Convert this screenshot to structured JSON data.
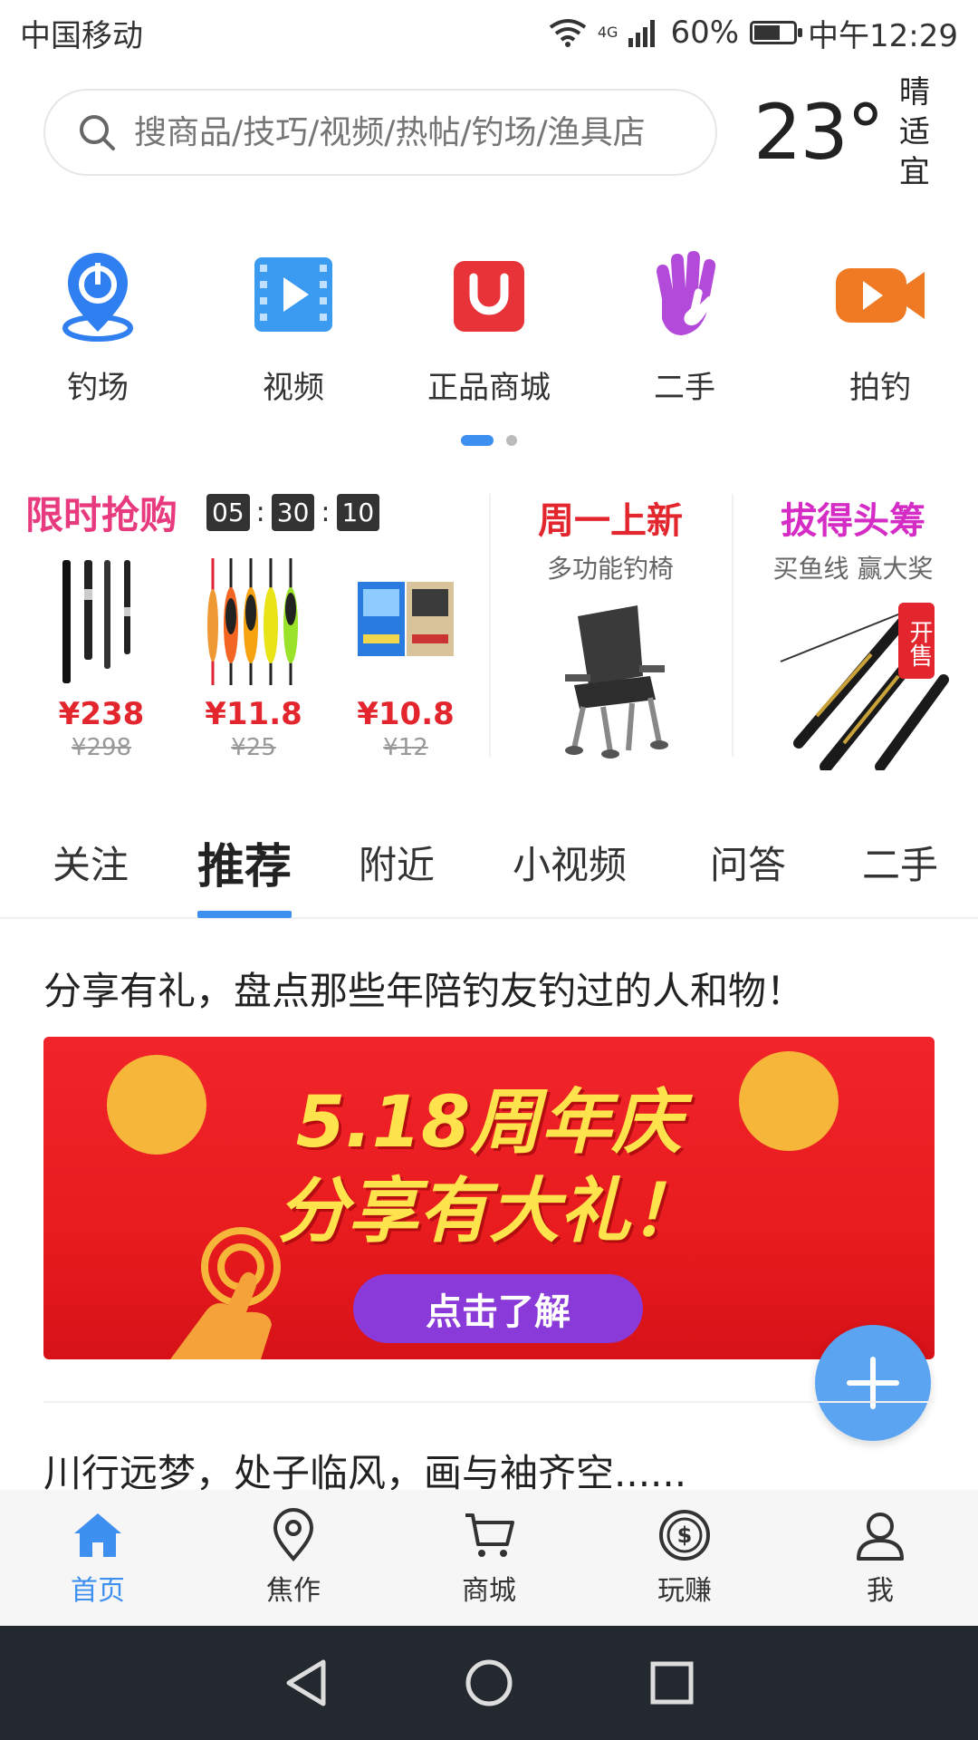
{
  "status": {
    "carrier": "中国移动",
    "network": "4G",
    "battery": "60%",
    "time": "中午12:29"
  },
  "search": {
    "placeholder": "搜商品/技巧/视频/热帖/钓场/渔具店"
  },
  "weather": {
    "temp": "23°",
    "condition": "晴",
    "comfort": "适宜"
  },
  "categories": [
    {
      "label": "钓场",
      "icon": "location-pin-icon",
      "color": "#2f7ff0"
    },
    {
      "label": "视频",
      "icon": "video-film-icon",
      "color": "#3b9bf0"
    },
    {
      "label": "正品商城",
      "icon": "shopping-bag-icon",
      "color": "#e83338"
    },
    {
      "label": "二手",
      "icon": "hand-icon",
      "color": "#b44ad9"
    },
    {
      "label": "拍钓",
      "icon": "camera-icon",
      "color": "#f07a24"
    }
  ],
  "flash_sale": {
    "title": "限时抢购",
    "timer": [
      "05",
      "30",
      "10"
    ],
    "items": [
      {
        "price": "¥238",
        "original": "¥298",
        "image": "fishing-rod-image"
      },
      {
        "price": "¥11.8",
        "original": "¥25",
        "image": "fishing-float-image"
      },
      {
        "price": "¥10.8",
        "original": "¥12",
        "image": "bait-pack-image"
      }
    ]
  },
  "promo_cards": [
    {
      "title": "周一上新",
      "subtitle": "多功能钓椅",
      "title_color": "#e3262d"
    },
    {
      "title": "拔得头筹",
      "subtitle": "买鱼线 赢大奖",
      "title_color": "#d52cc6",
      "badge": "开售"
    }
  ],
  "tabs": [
    "关注",
    "推荐",
    "附近",
    "小视频",
    "问答",
    "二手"
  ],
  "active_tab": "推荐",
  "feed": {
    "post1_title": "分享有礼，盘点那些年陪钓友钓过的人和物！",
    "banner": {
      "line1": "5.18周年庆",
      "line2": "分享有大礼！",
      "button": "点击了解"
    },
    "post2_title": "川行远梦，处子临风，画与袖齐空......"
  },
  "bottom_nav": [
    {
      "label": "首页",
      "icon": "home-icon",
      "active": true
    },
    {
      "label": "焦作",
      "icon": "location-icon",
      "active": false
    },
    {
      "label": "商城",
      "icon": "cart-icon",
      "active": false
    },
    {
      "label": "玩赚",
      "icon": "dollar-coin-icon",
      "active": false
    },
    {
      "label": "我",
      "icon": "user-icon",
      "active": false
    }
  ],
  "colors": {
    "accent": "#3d8ff0",
    "price": "#e3262d",
    "flash_title": "#e83a7e"
  }
}
